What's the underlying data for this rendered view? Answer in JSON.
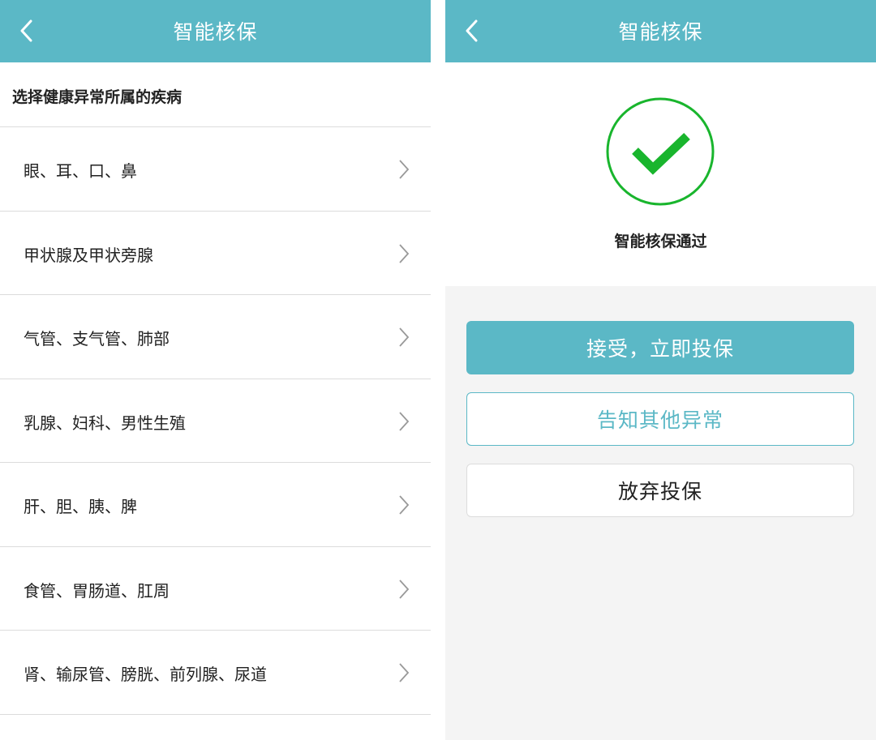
{
  "colors": {
    "accent": "#5bb8c6",
    "success": "#19b52d"
  },
  "left": {
    "header_title": "智能核保",
    "back_icon": "chevron-left-icon",
    "section_title": "选择健康异常所属的疾病",
    "items": [
      {
        "label": "眼、耳、口、鼻"
      },
      {
        "label": "甲状腺及甲状旁腺"
      },
      {
        "label": "气管、支气管、肺部"
      },
      {
        "label": "乳腺、妇科、男性生殖"
      },
      {
        "label": "肝、胆、胰、脾"
      },
      {
        "label": "食管、胃肠道、肛周"
      },
      {
        "label": "肾、输尿管、膀胱、前列腺、尿道"
      }
    ]
  },
  "right": {
    "header_title": "智能核保",
    "back_icon": "chevron-left-icon",
    "success_icon": "check-circle-icon",
    "status_text": "智能核保通过",
    "buttons": {
      "accept": "接受，立即投保",
      "notify": "告知其他异常",
      "abandon": "放弃投保"
    }
  }
}
